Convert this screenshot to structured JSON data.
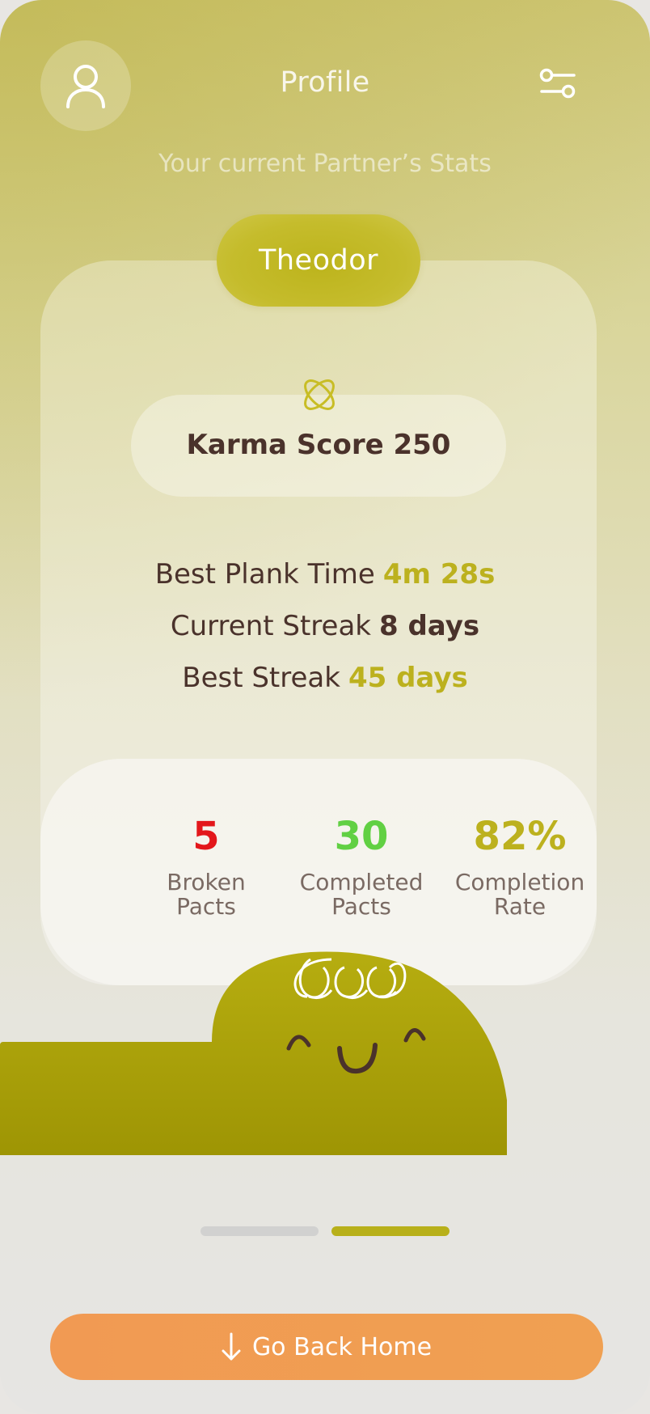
{
  "header": {
    "title": "Profile",
    "avatar_icon": "user-icon",
    "settings_icon": "sliders-icon"
  },
  "subtitle": "Your current Partner’s Stats",
  "partner": {
    "name": "Theodor"
  },
  "karma": {
    "icon": "atom-icon",
    "label": "Karma Score 250"
  },
  "stats": [
    {
      "label": "Best Plank Time",
      "value": "4m 28s"
    },
    {
      "label": "Current Streak",
      "value": "8 days"
    },
    {
      "label": "Best Streak",
      "value": "45 days"
    }
  ],
  "counters": [
    {
      "value": "5",
      "label_line1": "Broken",
      "label_line2": "Pacts",
      "color": "#e3171b"
    },
    {
      "value": "30",
      "label_line1": "Completed",
      "label_line2": "Pacts",
      "color": "#61d043"
    },
    {
      "value": "82%",
      "label_line1": "Completion",
      "label_line2": "Rate",
      "color": "#bcb11e"
    }
  ],
  "pager": {
    "current_page": 2,
    "total_pages": 2
  },
  "cta": {
    "label": "Go Back Home",
    "icon": "arrow-down-icon"
  },
  "colors": {
    "accent_olive": "#bcb11e",
    "mascot": "#a9a008",
    "button": "#f19a53",
    "text_dark": "#4a322b"
  }
}
